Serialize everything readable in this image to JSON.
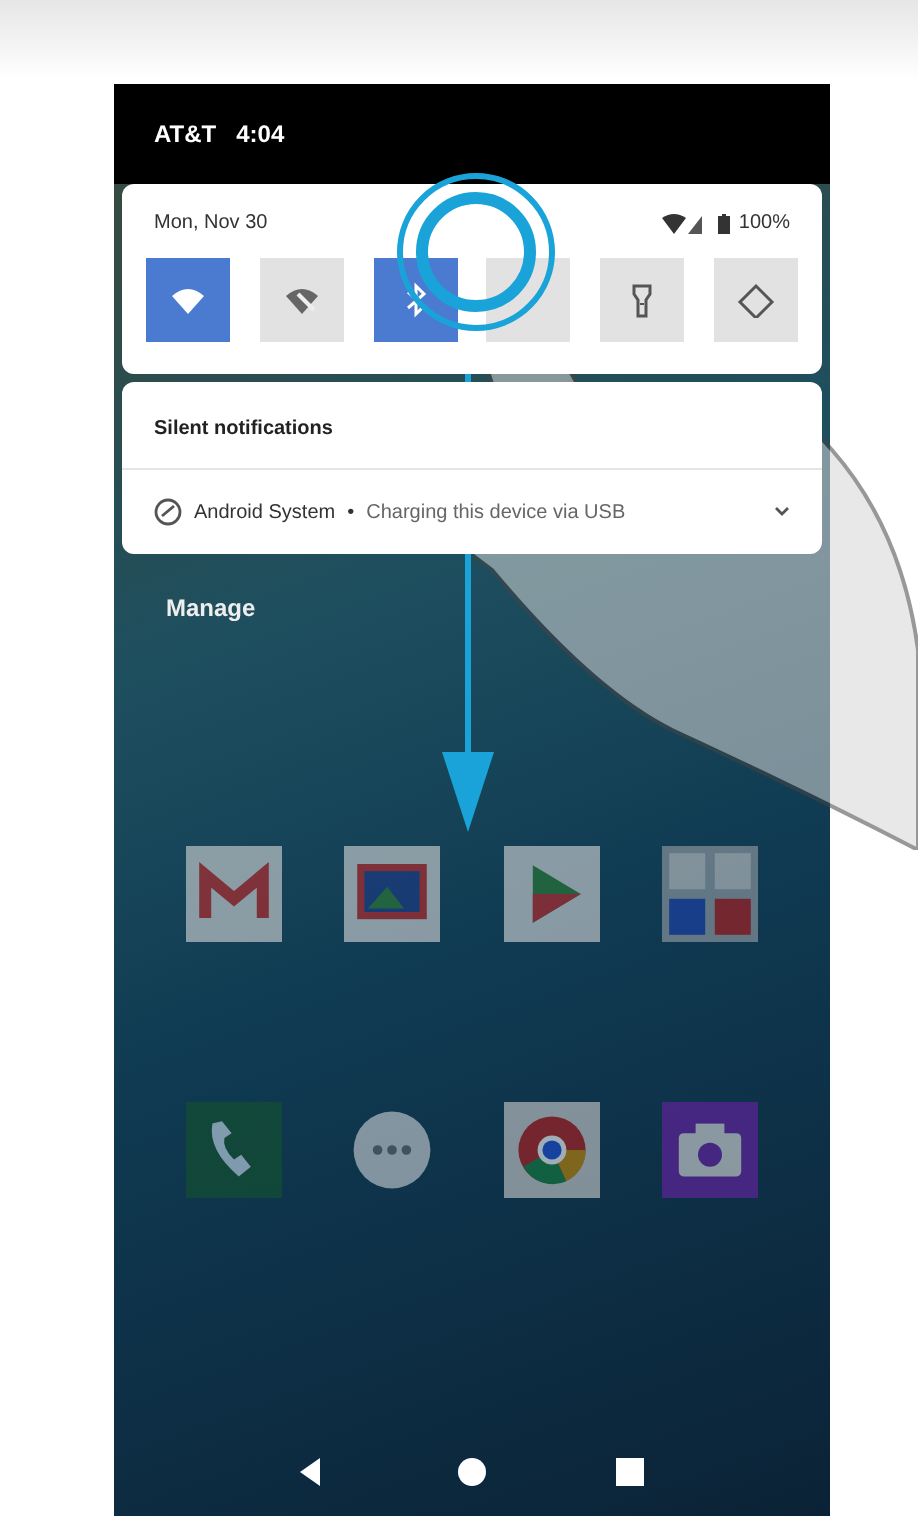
{
  "status_bar": {
    "carrier": "AT&T",
    "time": "4:04"
  },
  "quick_settings": {
    "date": "Mon, Nov 30",
    "battery": "100%",
    "tiles": [
      {
        "kind": "wifi",
        "on": true
      },
      {
        "kind": "data-saver",
        "on": false
      },
      {
        "kind": "bluetooth",
        "on": true
      },
      {
        "kind": "blank",
        "on": false
      },
      {
        "kind": "flashlight",
        "on": false
      },
      {
        "kind": "rotate",
        "on": false
      }
    ]
  },
  "notifications": {
    "header": "Silent notifications",
    "app": "Android System",
    "separator": "•",
    "message": "Charging this device via USB"
  },
  "manage": "Manage",
  "apps": [
    {
      "kind": "mail"
    },
    {
      "kind": "gallery"
    },
    {
      "kind": "store"
    },
    {
      "kind": "folder"
    }
  ],
  "dock": [
    {
      "kind": "phone"
    },
    {
      "kind": "messages"
    },
    {
      "kind": "browser"
    },
    {
      "kind": "camera"
    }
  ]
}
